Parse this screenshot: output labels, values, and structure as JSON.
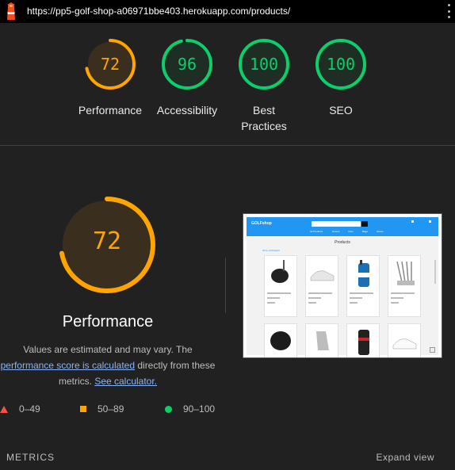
{
  "topbar": {
    "url": "https://pp5-golf-shop-a06971bbe403.herokuapp.com/products/",
    "logo_icon": "lighthouse-icon",
    "menu_icon": "kebab-menu-icon"
  },
  "gauges": [
    {
      "label": "Performance",
      "score": "72",
      "value": 72,
      "color": "#ffa400",
      "bg": "#3a2f1f"
    },
    {
      "label": "Accessibility",
      "score": "96",
      "value": 96,
      "color": "#0cce6b",
      "bg": "#1e2e24"
    },
    {
      "label": "Best Practices",
      "score": "100",
      "value": 100,
      "color": "#0cce6b",
      "bg": "#1e2e24"
    },
    {
      "label": "SEO",
      "score": "100",
      "value": 100,
      "color": "#0cce6b",
      "bg": "#1e2e24"
    }
  ],
  "performance": {
    "score": "72",
    "value": 72,
    "title": "Performance",
    "desc_prefix": "Values are estimated and may vary. The ",
    "desc_link1": "performance score is calculated",
    "desc_mid": " directly from these metrics. ",
    "desc_link2": "See calculator."
  },
  "legend": [
    {
      "range": "0–49",
      "color": "#ff4e42",
      "shape": "triangle"
    },
    {
      "range": "50–89",
      "color": "#ffa400",
      "shape": "square"
    },
    {
      "range": "90–100",
      "color": "#0cce6b",
      "shape": "circle"
    }
  ],
  "footer": {
    "metrics_label": "METRICS",
    "expand_label": "Expand view"
  },
  "thumbnail": {
    "logo": "GOLFshop",
    "page_title": "Products",
    "menu": [
      "All Products",
      "Drivers",
      "Irons",
      "Bags",
      "Shoes"
    ],
    "crumb": "Home / All Products"
  }
}
